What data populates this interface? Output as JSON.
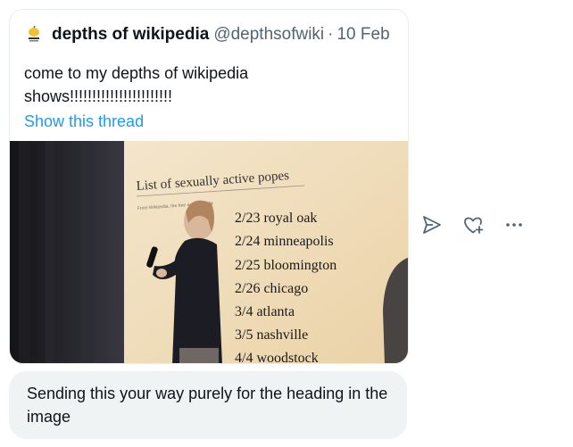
{
  "tweet": {
    "author_name": "depths of wikipedia",
    "author_handle": "@depthsofwiki",
    "separator": "·",
    "date": "10 Feb",
    "text": "come to my depths of wikipedia shows!!!!!!!!!!!!!!!!!!!!!!!",
    "show_thread_label": "Show this thread",
    "avatar_icon": "lemon-avatar-icon",
    "photo": {
      "screen_title": "List of sexually active popes",
      "screen_subtitle": "From Wikipedia, the free encyclopedia",
      "tour_dates": [
        "2/23 royal oak",
        "2/24 minneapolis",
        "2/25 bloomington",
        "2/26 chicago",
        "3/4 atlanta",
        "3/5 nashville",
        "4/4 woodstock"
      ]
    }
  },
  "actions": {
    "icons": [
      "send-icon",
      "heart-add-icon",
      "more-icon"
    ],
    "icon_color": "#536471"
  },
  "message": {
    "text": "Sending this your way purely for the heading in the image"
  },
  "colors": {
    "link": "#1d9bf0",
    "secondary_text": "#536471",
    "bubble_bg": "#eff3f4"
  }
}
